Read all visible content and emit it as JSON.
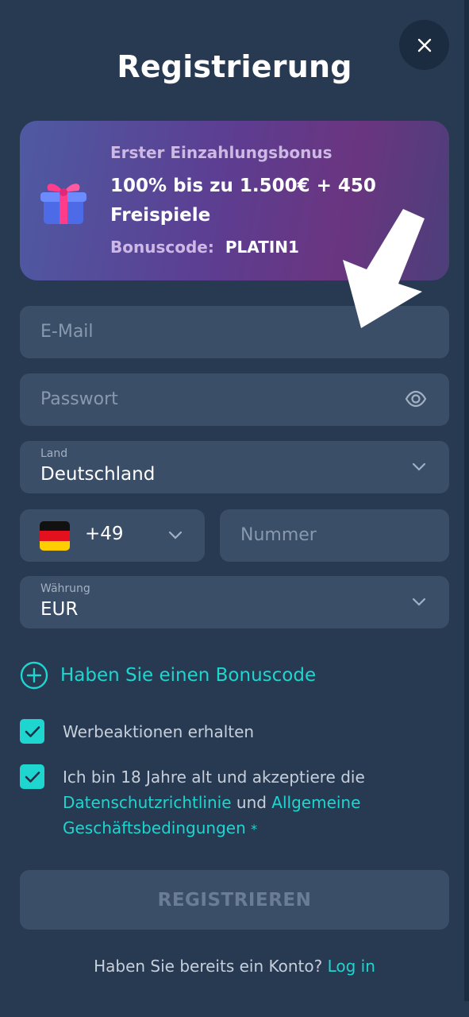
{
  "title": "Registrierung",
  "close_icon": "close-icon",
  "bonus": {
    "label": "Erster Einzahlungsbonus",
    "offer": "100% bis zu 1.500€ + 450 Freispiele",
    "code_label": "Bonuscode:",
    "code_value": "PLATIN1",
    "icon": "gift-icon"
  },
  "form": {
    "email_placeholder": "E-Mail",
    "password_placeholder": "Passwort",
    "country_label": "Land",
    "country_value": "Deutschland",
    "phone_code": "+49",
    "phone_placeholder": "Nummer",
    "currency_label": "Währung",
    "currency_value": "EUR"
  },
  "bonus_link": "Haben Sie einen Bonuscode",
  "checkboxes": {
    "promotions": "Werbeaktionen erhalten",
    "terms_prefix": "Ich bin 18 Jahre alt und akzeptiere die",
    "privacy_link": "Datenschutzrichtlinie",
    "and": "und",
    "terms_link_1": "Allgemeine",
    "terms_link_2": "Geschäftsbedingungen",
    "required_mark": "*"
  },
  "submit_label": "REGISTRIEREN",
  "footer": {
    "text": "Haben Sie bereits ein Konto?",
    "login_link": "Log in"
  },
  "colors": {
    "background": "#273a52",
    "field": "#3b4e68",
    "accent": "#1fd5d0"
  }
}
